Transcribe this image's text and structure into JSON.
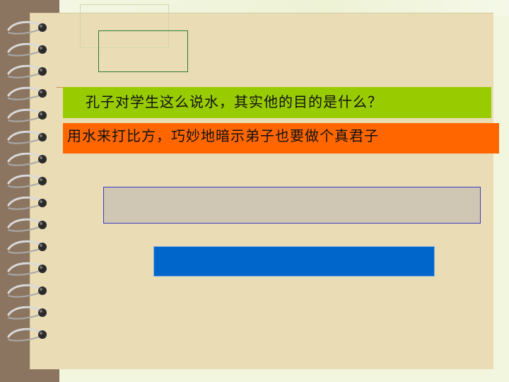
{
  "slide": {
    "question": "孔子对学生这么说水，其实他的目的是什么？",
    "answer": "用水来打比方，巧妙地暗示弟子也要做个真君子"
  },
  "colors": {
    "paper": "#eadcb5",
    "spine": "#8b7560",
    "question_bar": "#99cc00",
    "answer_bar": "#ff6600",
    "gray_box": "#cfc6b3",
    "blue_box": "#0066cc",
    "outline_green": "#2f7d2f"
  },
  "decor": {
    "ring_count": 15
  }
}
